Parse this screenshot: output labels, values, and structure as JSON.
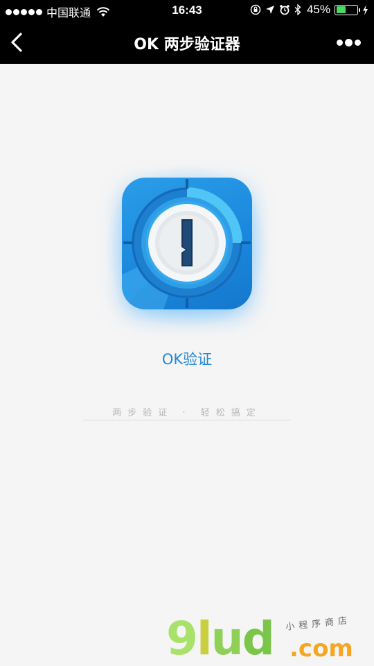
{
  "status_bar": {
    "carrier": "中国联通",
    "time": "16:43",
    "battery_percent": "45%",
    "battery_level": 0.45,
    "icons": [
      "signal-dots-icon",
      "wifi-icon",
      "rotation-lock-icon",
      "location-arrow-icon",
      "alarm-icon",
      "bluetooth-icon",
      "battery-icon",
      "charging-icon"
    ]
  },
  "navbar": {
    "title": "OK 两步验证器",
    "back_icon": "chevron-left-icon",
    "more_icon": "more-dots-icon"
  },
  "main": {
    "app_icon": "keyhole-lock-icon",
    "app_name": "OK验证",
    "tagline": "两步验证 · 轻松搞定"
  },
  "watermark": {
    "logo": [
      "9",
      "l",
      "u",
      "d"
    ],
    "subtitle": "小程序商店",
    "domain": ".com"
  },
  "colors": {
    "accent": "#2488d8",
    "icon_bg": "#1a86dc",
    "battery_fill": "#4cd964"
  }
}
